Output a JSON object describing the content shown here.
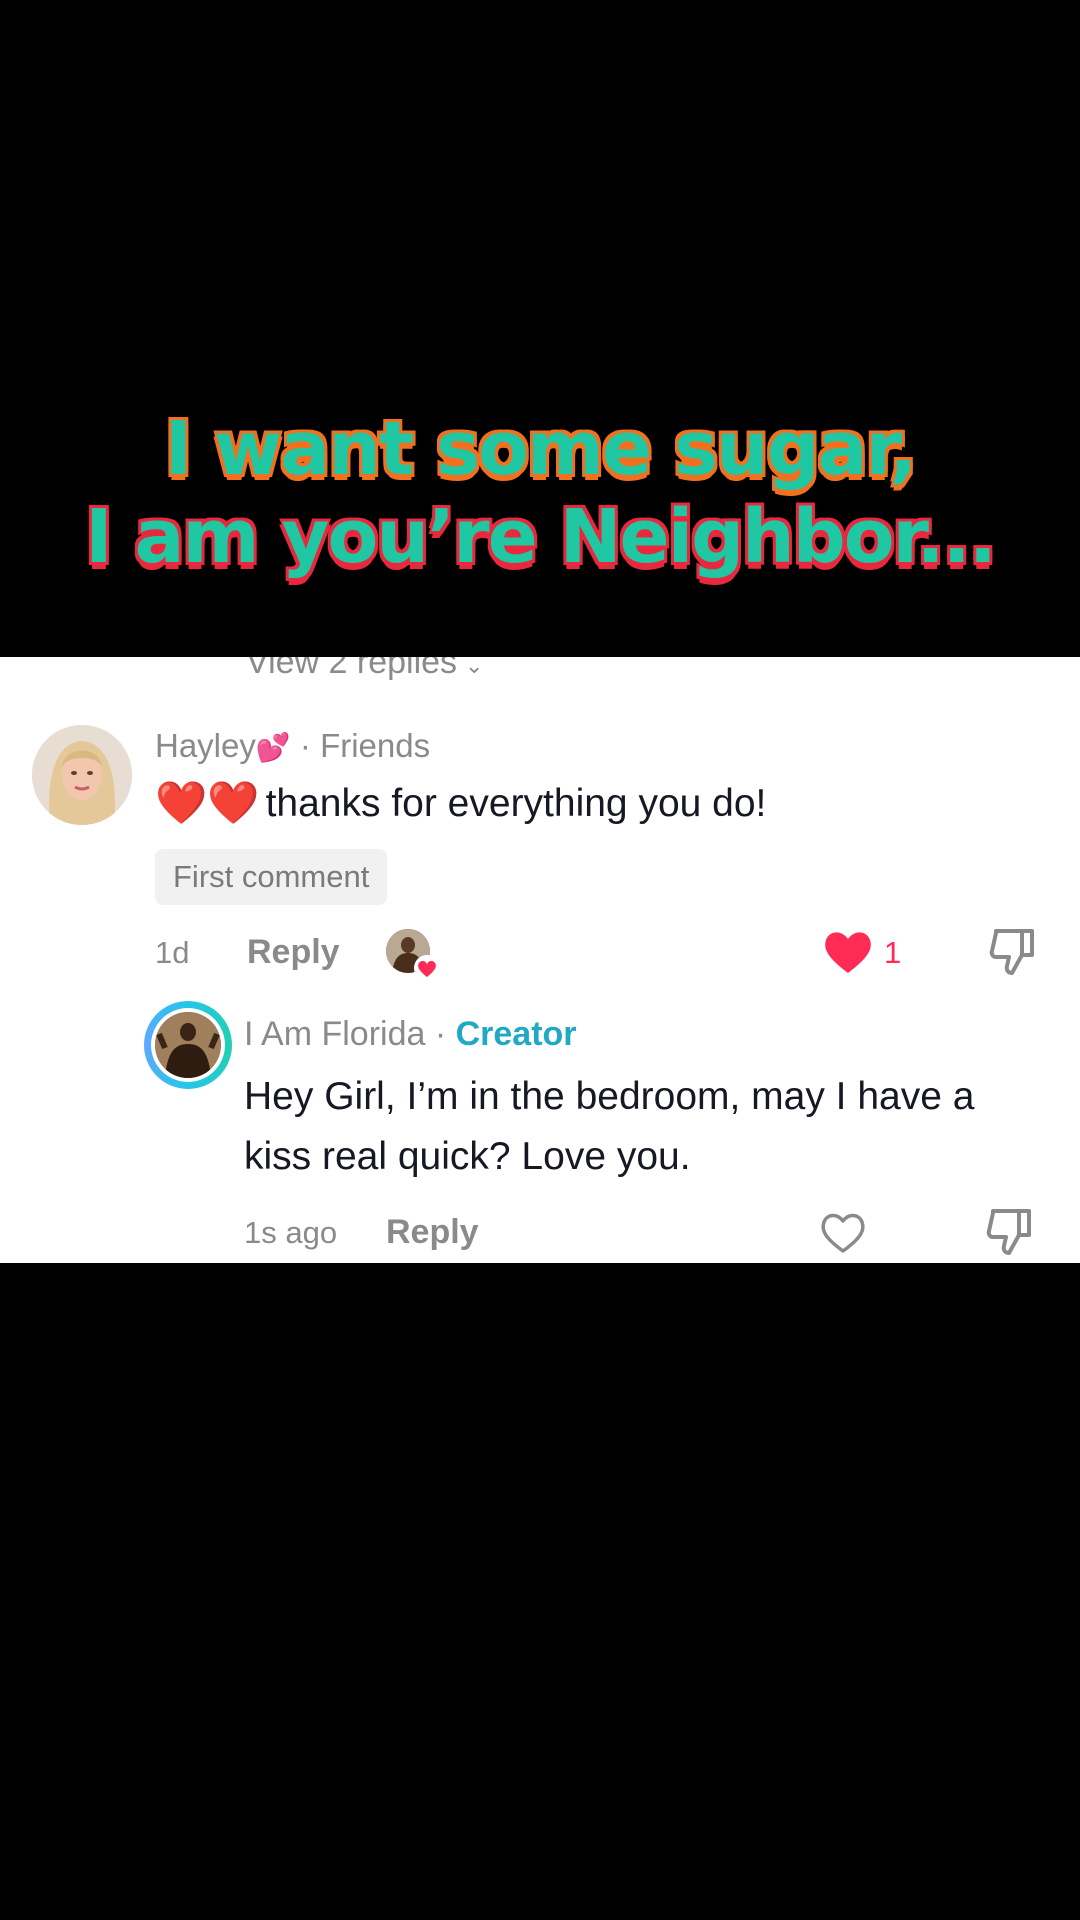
{
  "caption": {
    "line1": "I want some sugar,",
    "line2": "I am you’re Neighbor...",
    "fill_color": "#1fc7a3",
    "outline_color_line1": "#f07020",
    "outline_color_line2": "#e8283c"
  },
  "thread": {
    "view_replies": "View 2 replies",
    "comments": [
      {
        "username": "Hayley",
        "username_emoji": "💕",
        "relation": "· Friends",
        "emoji_prefix": "❤️❤️",
        "text": "thanks for everything you do!",
        "badge": "First comment",
        "time": "1d",
        "reply_label": "Reply",
        "like_count": "1",
        "liked": true,
        "liked_by_creator": true
      },
      {
        "username": "I Am Florida",
        "separator": " · ",
        "role": "Creator",
        "text": "Hey Girl, I’m in the bedroom, may I have a kiss real quick? Love you.",
        "time": "1s ago",
        "reply_label": "Reply",
        "liked": false
      }
    ]
  },
  "colors": {
    "like_active": "#fe2c55",
    "creator_label": "#20a9c2",
    "meta_gray": "#8a8a8a",
    "text_dark": "#161823"
  },
  "icons": [
    "heart-icon",
    "dislike-icon",
    "chevron-down-icon"
  ]
}
